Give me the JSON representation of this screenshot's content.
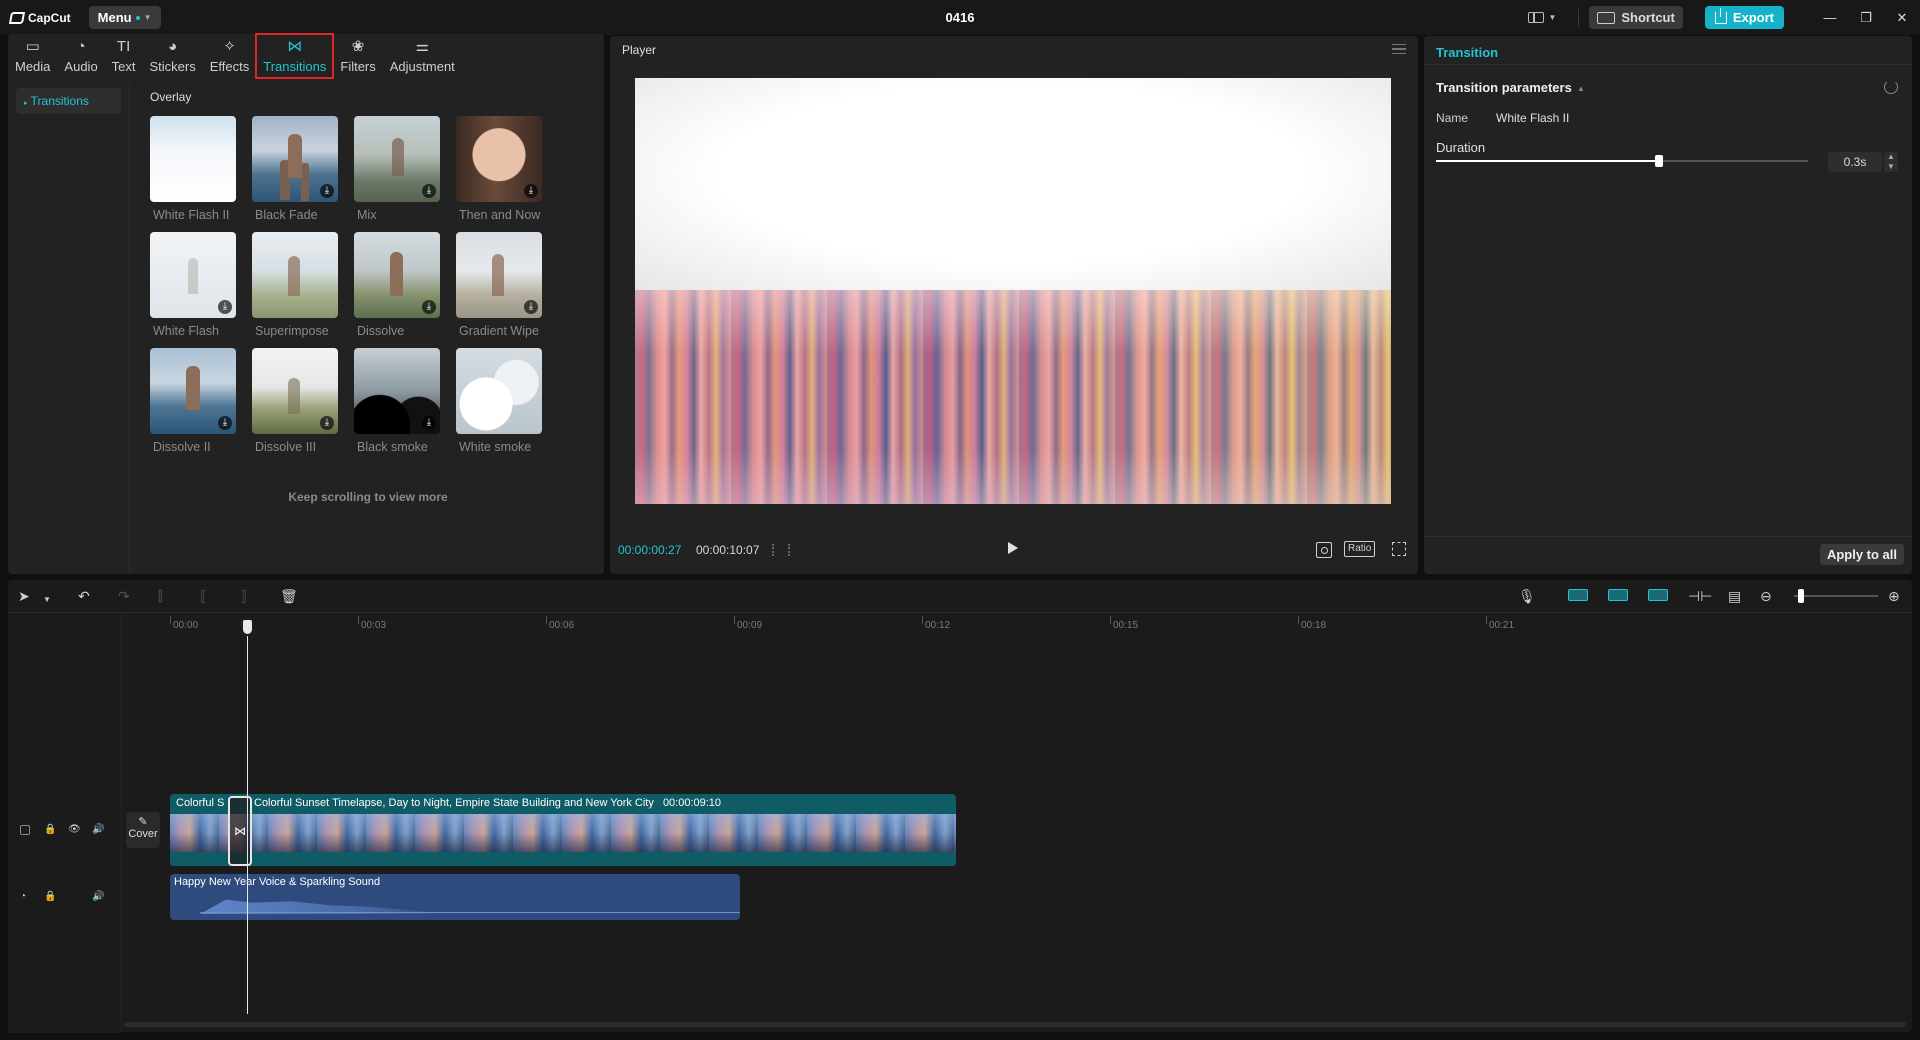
{
  "app": {
    "logo_text": "CapCut",
    "menu_label": "Menu",
    "project_title": "0416",
    "shortcut_label": "Shortcut",
    "export_label": "Export",
    "accent_color": "#23c3d4",
    "highlight_color": "#e0252b"
  },
  "media_tabs": [
    {
      "label": "Media",
      "icon": "media-icon",
      "glyph": "▭"
    },
    {
      "label": "Audio",
      "icon": "audio-icon",
      "glyph": "◔"
    },
    {
      "label": "Text",
      "icon": "text-icon",
      "glyph": "TI"
    },
    {
      "label": "Stickers",
      "icon": "sticker-icon",
      "glyph": "◕"
    },
    {
      "label": "Effects",
      "icon": "effects-icon",
      "glyph": "✧"
    },
    {
      "label": "Transitions",
      "icon": "transitions-icon",
      "glyph": "⋈",
      "active": true
    },
    {
      "label": "Filters",
      "icon": "filters-icon",
      "glyph": "❀"
    },
    {
      "label": "Adjustment",
      "icon": "adjustment-icon",
      "glyph": "⚌"
    }
  ],
  "media_sidebar": {
    "items": [
      {
        "label": "Transitions",
        "active": true
      }
    ]
  },
  "transitions": {
    "section_title": "Overlay",
    "items": [
      {
        "label": "White Flash II",
        "downloaded": true
      },
      {
        "label": "Black Fade",
        "downloaded": false
      },
      {
        "label": "Mix",
        "downloaded": false
      },
      {
        "label": "Then and Now",
        "downloaded": false
      },
      {
        "label": "White Flash",
        "downloaded": false
      },
      {
        "label": "Superimpose",
        "downloaded": true
      },
      {
        "label": "Dissolve",
        "downloaded": false
      },
      {
        "label": "Gradient Wipe",
        "downloaded": false
      },
      {
        "label": "Dissolve II",
        "downloaded": false
      },
      {
        "label": "Dissolve III",
        "downloaded": false
      },
      {
        "label": "Black smoke",
        "downloaded": false
      },
      {
        "label": "White smoke",
        "downloaded": true
      }
    ],
    "more_text": "Keep scrolling to view more"
  },
  "player": {
    "title": "Player",
    "current_time": "00:00:00:27",
    "total_time": "00:00:10:07",
    "ratio_label": "Ratio"
  },
  "properties": {
    "tab_title": "Transition",
    "section_title": "Transition parameters",
    "name_label": "Name",
    "name_value": "White Flash II",
    "duration_label": "Duration",
    "duration_value": "0.3s",
    "duration_fraction": 0.6,
    "apply_all_label": "Apply to all"
  },
  "timeline": {
    "ruler_labels": [
      "00:00",
      "00:03",
      "00:06",
      "00:09",
      "00:12",
      "00:15",
      "00:18",
      "00:21"
    ],
    "cover_label": "Cover",
    "video_clip_left_label": "Colorful S",
    "video_clip_label": "Colorful Sunset Timelapse, Day to Night, Empire State Building and New York City",
    "video_clip_duration": "00:00:09:10",
    "audio_clip_label": "Happy New Year Voice & Sparkling Sound",
    "zoom_fraction": 0.05
  }
}
